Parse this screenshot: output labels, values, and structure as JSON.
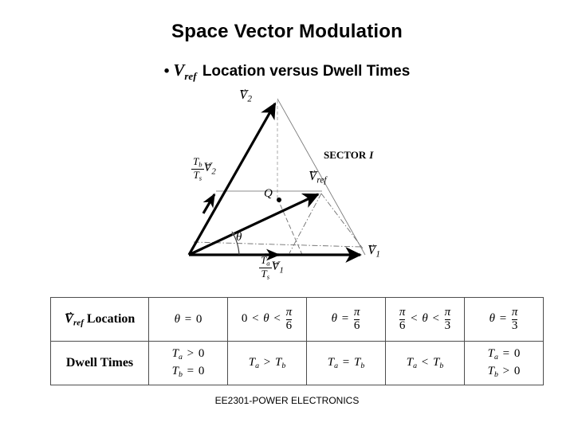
{
  "slide": {
    "title": "Space Vector Modulation",
    "bullet": {
      "marker": "•",
      "vector_symbol": "V",
      "vector_subscript": "ref",
      "text": " Location versus Dwell Times"
    },
    "footer": "EE2301-POWER ELECTRONICS"
  },
  "diagram": {
    "name": "space-vector-hexagon-sector-1",
    "sector_label": "SECTOR",
    "sector_number": "I",
    "labels": {
      "v1": {
        "symbol": "V",
        "subscript": "1",
        "accent": "vector"
      },
      "v2": {
        "symbol": "V",
        "subscript": "2",
        "accent": "vector"
      },
      "vref": {
        "symbol": "V",
        "subscript": "ref",
        "accent": "vector"
      },
      "q_point": "Q",
      "theta": "θ",
      "tb_over_ts_v2": {
        "numerator": "T",
        "numerator_sub": "b",
        "denominator": "T",
        "denominator_sub": "s",
        "vector_symbol": "V",
        "vector_subscript": "2"
      },
      "ta_over_ts_v1": {
        "numerator": "T",
        "numerator_sub": "a",
        "denominator": "T",
        "denominator_sub": "s",
        "vector_symbol": "V",
        "vector_subscript": "1"
      }
    },
    "colors": {
      "vector_stroke": "#000000",
      "construction_line": "#7a7a7a",
      "dashed_line": "#9a9a9a"
    }
  },
  "table": {
    "row_headers": [
      {
        "prefix_symbol": "V",
        "prefix_subscript": "ref",
        "label": "Location"
      },
      {
        "label": "Dwell Times"
      }
    ],
    "columns": [
      {
        "location": {
          "lhs": "θ",
          "op": "=",
          "rhs": "0"
        },
        "dwell": [
          {
            "lhs": "T",
            "lhs_sub": "a",
            "op": ">",
            "rhs": "0"
          },
          {
            "lhs": "T",
            "lhs_sub": "b",
            "op": "=",
            "rhs": "0"
          }
        ]
      },
      {
        "location": {
          "lhs": "0",
          "op": "<",
          "mid": "θ",
          "op2": "<",
          "frac_num": "π",
          "frac_den": "6"
        },
        "dwell": [
          {
            "lhs": "T",
            "lhs_sub": "a",
            "op": ">",
            "rhs": "T",
            "rhs_sub": "b"
          }
        ]
      },
      {
        "location": {
          "lhs": "θ",
          "op": "=",
          "frac_num": "π",
          "frac_den": "6"
        },
        "dwell": [
          {
            "lhs": "T",
            "lhs_sub": "a",
            "op": "=",
            "rhs": "T",
            "rhs_sub": "b"
          }
        ]
      },
      {
        "location": {
          "frac_num": "π",
          "frac_den": "6",
          "op": "<",
          "mid": "θ",
          "op2": "<",
          "frac2_num": "π",
          "frac2_den": "3"
        },
        "dwell": [
          {
            "lhs": "T",
            "lhs_sub": "a",
            "op": "<",
            "rhs": "T",
            "rhs_sub": "b"
          }
        ]
      },
      {
        "location": {
          "lhs": "θ",
          "op": "=",
          "frac_num": "π",
          "frac_den": "3"
        },
        "dwell": [
          {
            "lhs": "T",
            "lhs_sub": "a",
            "op": "=",
            "rhs": "0"
          },
          {
            "lhs": "T",
            "lhs_sub": "b",
            "op": ">",
            "rhs": "0"
          }
        ]
      }
    ]
  }
}
